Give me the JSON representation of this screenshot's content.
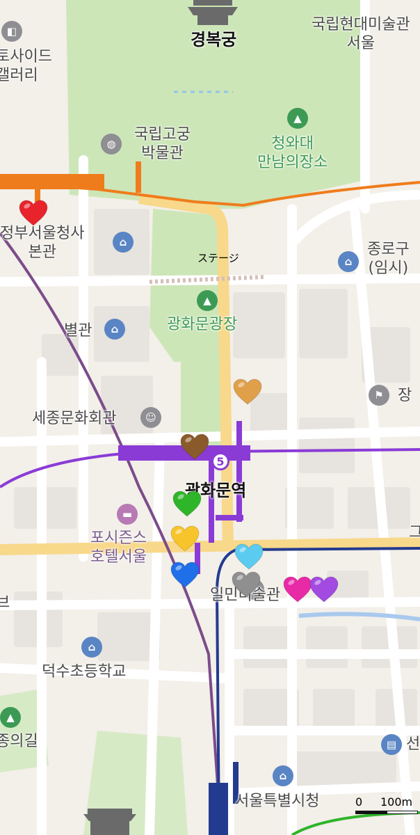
{
  "map": {
    "labels": {
      "gyeongbokgung": "경복궁",
      "mmca": "국립현대미술관\n서울",
      "national_palace_museum": "국립고궁\n박물관",
      "cheongwadae": "청와대\n만남의장소",
      "gov_complex": "정부서울청사\n본관",
      "side_gallery": "토사이드\n갤러리",
      "stage": "ステージ",
      "jongno_office": "종로구\n(임시)",
      "gwanghwamun_plaza": "광화문광장",
      "annex": "별관",
      "sejong_center": "세종문화회관",
      "jang": "장",
      "station": "광화문역",
      "station_number": "5",
      "four_seasons": "포시즌스\n호텔서울",
      "ilmin": "일민미술관",
      "deoksu_school": "덕수초등학교",
      "jongui": "종의길",
      "seoul_city_hall": "서울특별시청",
      "left_edge": "브",
      "right_edge_go": "그",
      "right_edge_sun": "선"
    },
    "scale": {
      "zero": "0",
      "distance": "100m"
    },
    "hearts": [
      {
        "name": "red-heart",
        "color": "#e8232c"
      },
      {
        "name": "orange-heart",
        "color": "#e0a04a"
      },
      {
        "name": "brown-heart",
        "color": "#8b5a2b"
      },
      {
        "name": "green-heart",
        "color": "#2fb52a"
      },
      {
        "name": "yellow-heart",
        "color": "#f7c52b"
      },
      {
        "name": "blue-heart",
        "color": "#1f6fe8"
      },
      {
        "name": "light-blue-heart",
        "color": "#5ccbf0"
      },
      {
        "name": "gray-heart",
        "color": "#8f8f8f"
      },
      {
        "name": "pink-heart",
        "color": "#e82aa6"
      },
      {
        "name": "purple-heart",
        "color": "#a34be0"
      }
    ],
    "colors": {
      "line1": "#233b8f",
      "line3": "#ef7c1c",
      "line5": "#8a3bd6",
      "airport_line": "#7b4c8a",
      "park": "#cde6b8",
      "road": "#ffffff",
      "major_road": "#f8d88a"
    }
  }
}
